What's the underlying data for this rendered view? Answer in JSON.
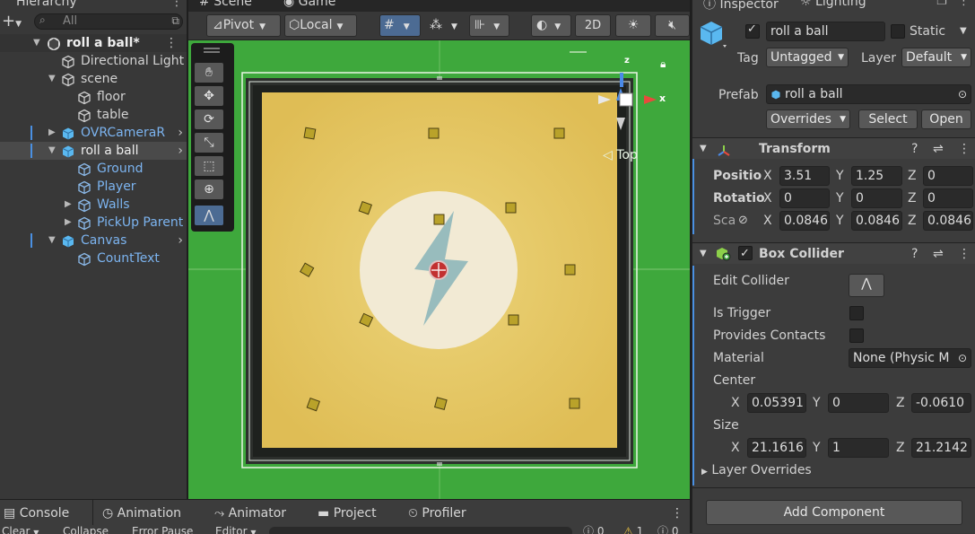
{
  "hierarchy": {
    "tab": "Hierarchy",
    "add_label": "+",
    "search_placeholder": "All",
    "items": [
      {
        "label": "roll a ball*"
      },
      {
        "label": "Directional Light"
      },
      {
        "label": "scene"
      },
      {
        "label": "floor"
      },
      {
        "label": "table"
      },
      {
        "label": "OVRCameraR"
      },
      {
        "label": "roll a ball"
      },
      {
        "label": "Ground"
      },
      {
        "label": "Player"
      },
      {
        "label": "Walls"
      },
      {
        "label": "PickUp Parent"
      },
      {
        "label": "Canvas"
      },
      {
        "label": "CountText"
      }
    ]
  },
  "scene": {
    "tab_scene": "Scene",
    "tab_game": "Game",
    "pivot": "Pivot",
    "local": "Local",
    "mode_2d": "2D",
    "orientation_label": "Top",
    "axis_x": "x",
    "axis_z": "z"
  },
  "inspector": {
    "tab_inspector": "Inspector",
    "tab_lighting": "Lighting",
    "object_name": "roll a ball",
    "static_label": "Static",
    "tag_label": "Tag",
    "tag_value": "Untagged",
    "layer_label": "Layer",
    "layer_value": "Default",
    "prefab_label": "Prefab",
    "prefab_value": "roll a ball",
    "overrides_label": "Overrides",
    "select_label": "Select",
    "open_label": "Open",
    "transform": {
      "title": "Transform",
      "position_label": "Positio",
      "rotation_label": "Rotatio",
      "scale_label": "Sca",
      "x": "X",
      "y": "Y",
      "z": "Z",
      "position": [
        "3.51",
        "1.25",
        "0"
      ],
      "rotation": [
        "0",
        "0",
        "0"
      ],
      "scale": [
        "0.0846",
        "0.0846",
        "0.0846"
      ]
    },
    "box_collider": {
      "title": "Box Collider",
      "edit_collider": "Edit Collider",
      "is_trigger": "Is Trigger",
      "provides_contacts": "Provides Contacts",
      "material_label": "Material",
      "material_value": "None (Physic M",
      "center_label": "Center",
      "center": [
        "0.05391",
        "0",
        "-0.0610"
      ],
      "size_label": "Size",
      "size": [
        "21.1616",
        "1",
        "21.2142"
      ],
      "layer_overrides": "Layer Overrides"
    },
    "add_component": "Add Component"
  },
  "bottom": {
    "tabs": [
      "Console",
      "Animation",
      "Animator",
      "Project",
      "Profiler"
    ],
    "clear": "Clear",
    "collapse": "Collapse",
    "error_pause": "Error Pause",
    "editor": "Editor",
    "count_errors": "0",
    "count_warnings": "1",
    "count_info": "0"
  },
  "colors": {
    "viewport_bg": "#3ea83c",
    "floor": "#e6c65e",
    "selection_blue": "#7cb4f0",
    "axis_x": "#e84a3c",
    "axis_y": "#8cd04a",
    "axis_z": "#4a8ae8"
  }
}
